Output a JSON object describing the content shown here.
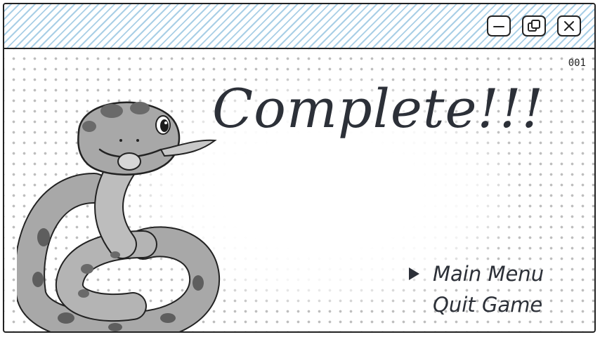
{
  "window": {
    "controls": [
      {
        "name": "minimize-icon"
      },
      {
        "name": "restore-icon"
      },
      {
        "name": "close-icon"
      }
    ]
  },
  "hud": {
    "counter": "001"
  },
  "screen": {
    "headline": "Complete!!!",
    "menu": [
      {
        "label": "Main Menu",
        "selected": true
      },
      {
        "label": "Quit Game",
        "selected": false
      }
    ]
  },
  "colors": {
    "ink": "#2c3038",
    "titlebar_stripe": "#a9cfe6",
    "dot": "#bdbdbd",
    "snake_body": "#a8a8a8",
    "snake_spot": "#5e5e5e"
  }
}
